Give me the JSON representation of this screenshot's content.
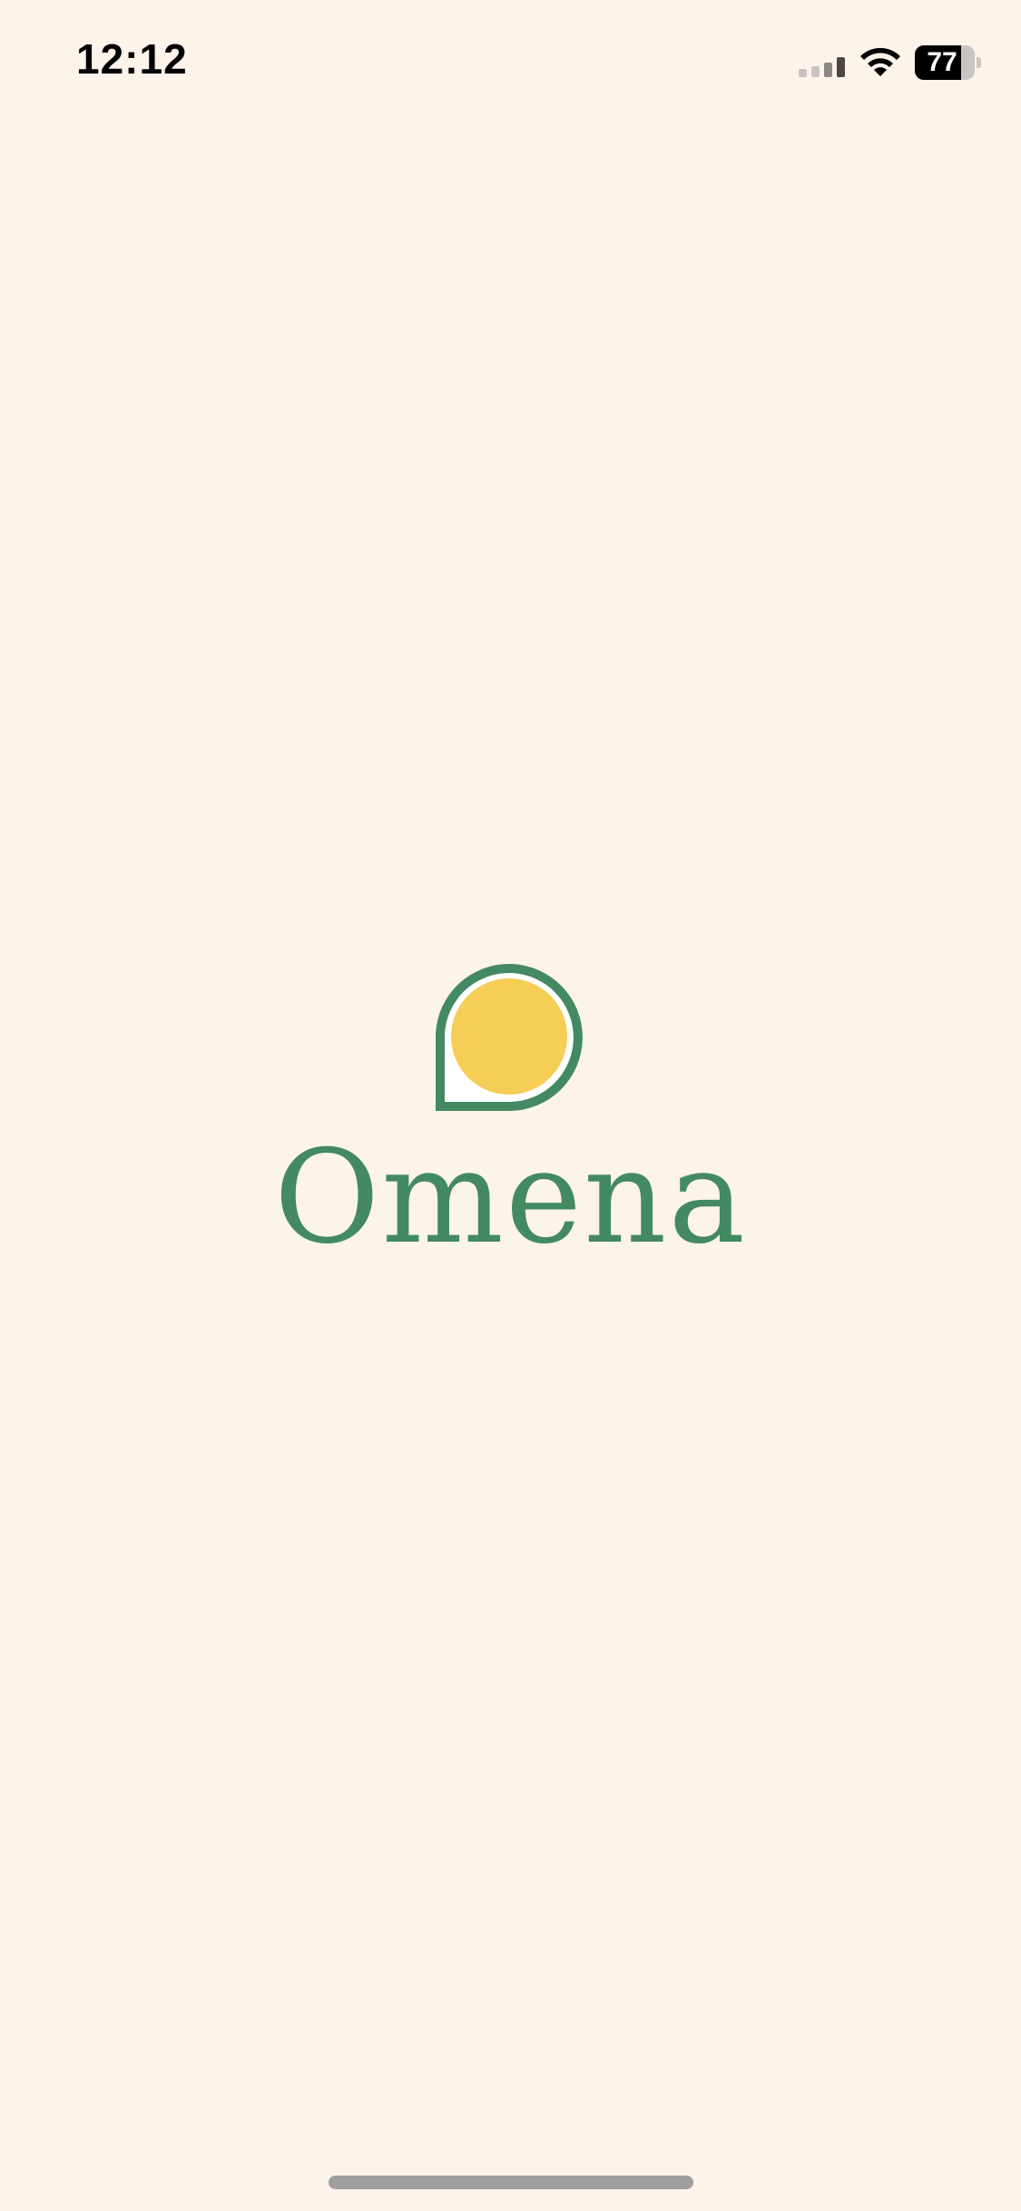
{
  "status_bar": {
    "time": "12:12",
    "battery_level": "77",
    "battery_fraction": 0.77
  },
  "splash": {
    "app_name": "Omena"
  },
  "colors": {
    "background": "#fcf3e9",
    "brand_green": "#438a62",
    "brand_yellow": "#f6cd55"
  },
  "icons": [
    "signal-icon",
    "wifi-icon",
    "battery-icon",
    "omena-logo-icon"
  ]
}
